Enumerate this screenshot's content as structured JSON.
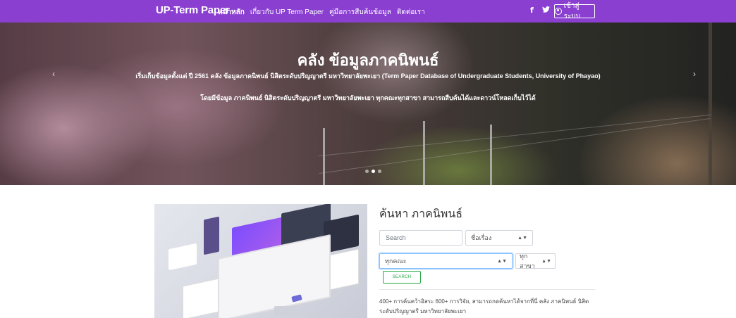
{
  "navbar": {
    "brand": "UP-Term Paper",
    "links": [
      {
        "label": "หน้าหลัก",
        "active": true
      },
      {
        "label": "เกี่ยวกับ UP Term Paper",
        "active": false
      },
      {
        "label": "คู่มือการสืบค้นข้อมูล",
        "active": false
      },
      {
        "label": "ติดต่อเรา",
        "active": false
      }
    ],
    "social": {
      "facebook": "f",
      "twitter": "t"
    },
    "login_label": "เข้าสู่ระบบ",
    "accent_color": "#8a3fd1"
  },
  "hero": {
    "title": "คลัง ข้อมูลภาคนิพนธ์",
    "subtitle1": "เริ่มเก็บข้อมูลตั้งแต่ ปี 2561 คลัง ข้อมูลภาคนิพนธ์ นิสิตระดับปริญญาตรี มหาวิทยาลัยพะเยา (Term Paper Database of Undergraduate Students, University of Phayao)",
    "subtitle2": "โดยมีข้อมูล ภาคนิพนธ์ นิสิตระดับปริญญาตรี มหาวิทยาลัยพะเยา ทุกคณะทุกสาขา สามารถสืบค้นได้และดาวน์โหลดเก็บไว้ได้",
    "prev_glyph": "‹",
    "next_glyph": "›",
    "slides": 3,
    "active_slide": 1
  },
  "search": {
    "title": "ค้นหา ภาคนิพนธ์",
    "placeholder": "Search",
    "field_select": "ชื่อเรื่อง",
    "faculty_select": "ทุกคณะ",
    "branch_select": "ทุกสาขา",
    "button_label": "SEARCH",
    "button_color": "#28a745"
  },
  "description": "400+ การค้นคว้าอิสระ 600+ การวิจัย, สามารถกดค้นหาได้จากที่นี่ คลัง ภาคนิพนธ์ นิสิตระดับปริญญาตรี มหาวิทยาลัยพะเยา"
}
